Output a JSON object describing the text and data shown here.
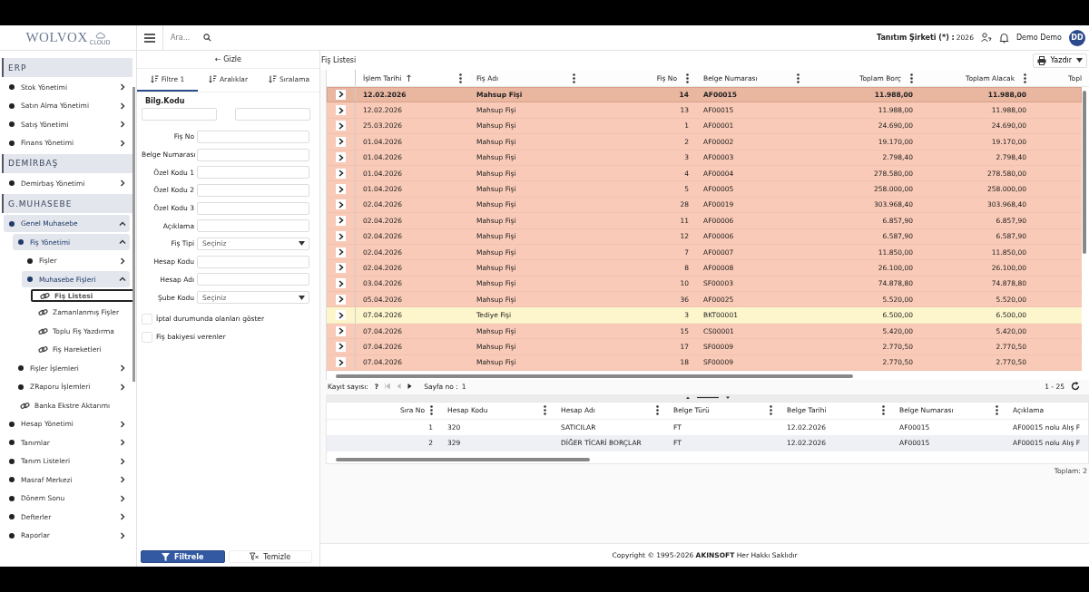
{
  "header": {
    "logo": "WOLVOX",
    "logo_sub": "CLOUD",
    "search": {
      "placeholder": "Ara..."
    },
    "company": "Tanıtım Şirketi (*) :",
    "year": "2026",
    "user": "Demo Demo",
    "avatar": "DD"
  },
  "sidebar": {
    "sections": [
      {
        "title": "ERP",
        "items": [
          {
            "kind": "menu",
            "label": "Stok Yönetimi",
            "expanded": false,
            "selected": false
          },
          {
            "kind": "menu",
            "label": "Satın Alma Yönetimi",
            "expanded": false,
            "selected": false
          },
          {
            "kind": "menu",
            "label": "Satış Yönetimi",
            "expanded": false,
            "selected": false
          },
          {
            "kind": "menu",
            "label": "Finans Yönetimi",
            "expanded": false,
            "selected": false
          }
        ]
      },
      {
        "title": "DEMİRBAŞ",
        "items": [
          {
            "kind": "menu",
            "label": "Demirbaş Yönetimi",
            "expanded": false,
            "selected": false
          }
        ]
      },
      {
        "title": "G.MUHASEBE",
        "items": [
          {
            "kind": "menu",
            "label": "Genel Muhasebe",
            "expanded": true,
            "selected": false,
            "children": [
              {
                "kind": "menu",
                "label": "Fiş Yönetimi",
                "expanded": true,
                "selected": false,
                "children": [
                  {
                    "kind": "menu",
                    "label": "Fişler",
                    "expanded": false,
                    "selected": false
                  },
                  {
                    "kind": "menu",
                    "label": "Muhasebe Fişleri",
                    "expanded": true,
                    "selected": false,
                    "children": [
                      {
                        "kind": "link",
                        "label": "Fiş Listesi",
                        "selected": true
                      },
                      {
                        "kind": "link",
                        "label": "Zamanlanmış Fişler",
                        "selected": false
                      },
                      {
                        "kind": "link",
                        "label": "Toplu Fiş Yazdırma",
                        "selected": false
                      },
                      {
                        "kind": "link",
                        "label": "Fiş Hareketleri",
                        "selected": false
                      }
                    ]
                  }
                ]
              },
              {
                "kind": "menu",
                "label": "Fişler İşlemleri",
                "expanded": false,
                "selected": false
              },
              {
                "kind": "menu",
                "label": "ZRaporu İşlemleri",
                "expanded": false,
                "selected": false
              },
              {
                "kind": "link",
                "label": "Banka Ekstre Aktarımı",
                "selected": false
              }
            ]
          },
          {
            "kind": "menu",
            "label": "Hesap Yönetimi",
            "expanded": false,
            "selected": false
          },
          {
            "kind": "menu",
            "label": "Tanımlar",
            "expanded": false,
            "selected": false
          },
          {
            "kind": "menu",
            "label": "Tanım Listeleri",
            "expanded": false,
            "selected": false
          },
          {
            "kind": "menu",
            "label": "Masraf Merkezi",
            "expanded": false,
            "selected": false
          },
          {
            "kind": "menu",
            "label": "Dönem Sonu",
            "expanded": false,
            "selected": false
          },
          {
            "kind": "menu",
            "label": "Defterler",
            "expanded": false,
            "selected": false
          },
          {
            "kind": "menu",
            "label": "Raporlar",
            "expanded": false,
            "selected": false
          }
        ]
      }
    ]
  },
  "filter_panel": {
    "hide_button": "← Gizle",
    "tabs": [
      {
        "label": "Filtre 1",
        "selected": true
      },
      {
        "label": "Aralıklar",
        "selected": false
      },
      {
        "label": "Sıralama",
        "selected": false
      }
    ],
    "range_label": "Bilg.Kodu",
    "fields": [
      {
        "kind": "text",
        "label": "Fiş No"
      },
      {
        "kind": "text",
        "label": "Belge Numarası"
      },
      {
        "kind": "text",
        "label": "Özel Kodu 1"
      },
      {
        "kind": "text",
        "label": "Özel Kodu 2"
      },
      {
        "kind": "text",
        "label": "Özel Kodu 3"
      },
      {
        "kind": "text",
        "label": "Açıklama"
      },
      {
        "kind": "select",
        "label": "Fiş Tipi",
        "value": "Seçiniz"
      },
      {
        "kind": "text",
        "label": "Hesap Kodu"
      },
      {
        "kind": "text",
        "label": "Hesap Adı"
      },
      {
        "kind": "select",
        "label": "Şube Kodu",
        "value": "Seçiniz"
      }
    ],
    "checkboxes": [
      {
        "label": "İptal durumunda olanları göster",
        "checked": false
      },
      {
        "label": "Fiş bakiyesi verenler",
        "checked": false
      }
    ],
    "buttons": [
      {
        "kind": "primary",
        "label": "Filtrele"
      },
      {
        "kind": "secondary",
        "label": "Temizle"
      }
    ]
  },
  "main": {
    "title": "Fiş Listesi",
    "print_button": "Yazdır",
    "table": {
      "columns": [
        {
          "label": "İşlem Tarihi",
          "sorted": true
        },
        {
          "label": "Fiş Adı",
          "sorted": false
        },
        {
          "label": "Fiş No",
          "sorted": false
        },
        {
          "label": "Belge Numarası",
          "sorted": false
        },
        {
          "label": "Toplam Borç",
          "sorted": false
        },
        {
          "label": "Toplam Alacak",
          "sorted": false
        },
        {
          "label": "Topl",
          "sorted": false
        }
      ],
      "rows": [
        {
          "cells": [
            "12.02.2026",
            "Mahsup Fişi",
            "14",
            "AF00015",
            "11.988,00",
            "11.988,00"
          ],
          "color": "#f9cab7",
          "selected": true
        },
        {
          "cells": [
            "12.02.2026",
            "Mahsup Fişi",
            "13",
            "AF00015",
            "11.988,00",
            "11.988,00"
          ],
          "color": "#f9cab7",
          "selected": false
        },
        {
          "cells": [
            "25.03.2026",
            "Mahsup Fişi",
            "1",
            "AF00001",
            "24.690,00",
            "24.690,00"
          ],
          "color": "#f9cab7",
          "selected": false
        },
        {
          "cells": [
            "01.04.2026",
            "Mahsup Fişi",
            "2",
            "AF00002",
            "19.170,00",
            "19.170,00"
          ],
          "color": "#f9cab7",
          "selected": false
        },
        {
          "cells": [
            "01.04.2026",
            "Mahsup Fişi",
            "3",
            "AF00003",
            "2.798,40",
            "2.798,40"
          ],
          "color": "#f9cab7",
          "selected": false
        },
        {
          "cells": [
            "01.04.2026",
            "Mahsup Fişi",
            "4",
            "AF00004",
            "278.580,00",
            "278.580,00"
          ],
          "color": "#f9cab7",
          "selected": false
        },
        {
          "cells": [
            "01.04.2026",
            "Mahsup Fişi",
            "5",
            "AF00005",
            "258.000,00",
            "258.000,00"
          ],
          "color": "#f9cab7",
          "selected": false
        },
        {
          "cells": [
            "02.04.2026",
            "Mahsup Fişi",
            "28",
            "AF00019",
            "303.968,40",
            "303.968,40"
          ],
          "color": "#f9cab7",
          "selected": false
        },
        {
          "cells": [
            "02.04.2026",
            "Mahsup Fişi",
            "11",
            "AF00006",
            "6.857,90",
            "6.857,90"
          ],
          "color": "#f9cab7",
          "selected": false
        },
        {
          "cells": [
            "02.04.2026",
            "Mahsup Fişi",
            "12",
            "AF00006",
            "6.587,90",
            "6.587,90"
          ],
          "color": "#f9cab7",
          "selected": false
        },
        {
          "cells": [
            "02.04.2026",
            "Mahsup Fişi",
            "7",
            "AF00007",
            "11.850,00",
            "11.850,00"
          ],
          "color": "#f9cab7",
          "selected": false
        },
        {
          "cells": [
            "02.04.2026",
            "Mahsup Fişi",
            "8",
            "AF00008",
            "26.100,00",
            "26.100,00"
          ],
          "color": "#f9cab7",
          "selected": false
        },
        {
          "cells": [
            "03.04.2026",
            "Mahsup Fişi",
            "10",
            "SF00003",
            "74.878,80",
            "74.878,80"
          ],
          "color": "#f9cab7",
          "selected": false
        },
        {
          "cells": [
            "05.04.2026",
            "Mahsup Fişi",
            "36",
            "AF00025",
            "5.520,00",
            "5.520,00"
          ],
          "color": "#f9cab7",
          "selected": false
        },
        {
          "cells": [
            "07.04.2026",
            "Tediye Fişi",
            "3",
            "BKT00001",
            "6.500,00",
            "6.500,00"
          ],
          "color": "#fdf6cc",
          "selected": false
        },
        {
          "cells": [
            "07.04.2026",
            "Mahsup Fişi",
            "15",
            "CS00001",
            "5.420,00",
            "5.420,00"
          ],
          "color": "#f9cab7",
          "selected": false
        },
        {
          "cells": [
            "07.04.2026",
            "Mahsup Fişi",
            "17",
            "SF00009",
            "2.770,50",
            "2.770,50"
          ],
          "color": "#f9cab7",
          "selected": false
        },
        {
          "cells": [
            "07.04.2026",
            "Mahsup Fişi",
            "18",
            "SF00009",
            "2.770,50",
            "2.770,50"
          ],
          "color": "#f9cab7",
          "selected": false
        }
      ]
    },
    "pager": {
      "count_label": "Kayıt sayısı:",
      "count": "?",
      "page_label": "Sayfa no :",
      "page": "1",
      "range": "1 - 25"
    },
    "detail_table": {
      "columns": [
        "Sıra No",
        "Hesap Kodu",
        "Hesap Adı",
        "Belge Türü",
        "Belge Tarihi",
        "Belge Numarası",
        "Açıklama"
      ],
      "rows": [
        [
          "1",
          "320",
          "SATICILAR",
          "FT",
          "12.02.2026",
          "AF00015",
          "AF00015 nolu Alış F"
        ],
        [
          "2",
          "329",
          "DİĞER TİCARİ BORÇLAR",
          "FT",
          "12.02.2026",
          "AF00015",
          "AF00015 nolu Alış F"
        ]
      ],
      "total": "Toplam: 2"
    },
    "footer": "Copyright © 1995-2026 **AKINSOFT** Her Hakkı Saklıdır"
  }
}
